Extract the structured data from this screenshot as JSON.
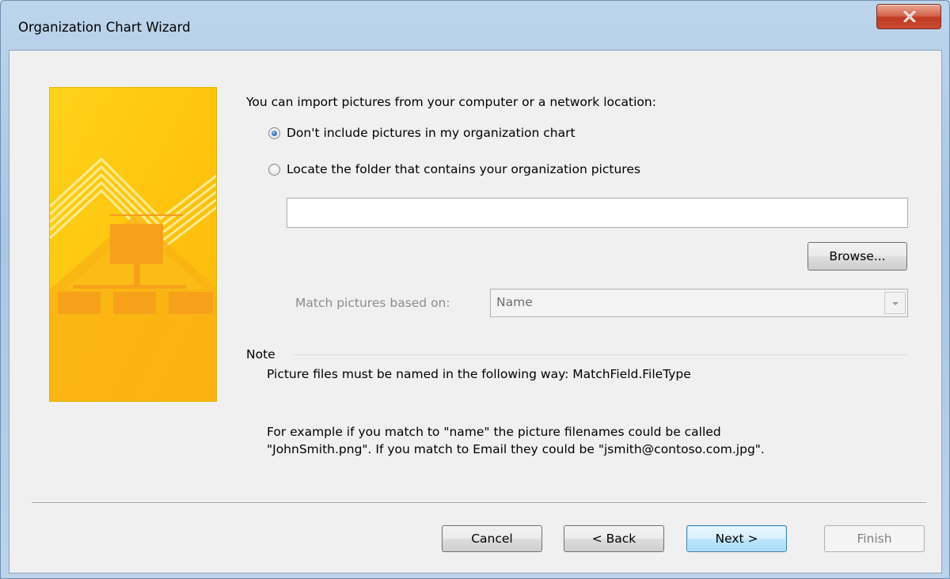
{
  "window": {
    "title": "Organization Chart Wizard"
  },
  "intro": "You can import pictures from your computer or a network location:",
  "options": {
    "no_pictures": "Don't include pictures in my organization chart",
    "locate_folder": "Locate the folder that contains your organization pictures",
    "selected": "no_pictures"
  },
  "folder_path": {
    "value": ""
  },
  "browse_label": "Browse...",
  "match": {
    "label": "Match pictures based on:",
    "value": "Name"
  },
  "note": {
    "label": "Note",
    "text": "Picture files must be named in the following way: MatchField.FileType",
    "example_line1": "For example if you match to \"name\" the picture filenames could be called",
    "example_line2": "\"JohnSmith.png\". If you match to Email they could be \"jsmith@contoso.com.jpg\"."
  },
  "buttons": {
    "cancel": "Cancel",
    "back": "< Back",
    "next": "Next >",
    "finish": "Finish"
  },
  "colors": {
    "banner_yellow": "#ffc20e",
    "banner_orange": "#f7a21b",
    "close_red": "#c94a35",
    "default_button_blue": "#3c7fb1"
  }
}
